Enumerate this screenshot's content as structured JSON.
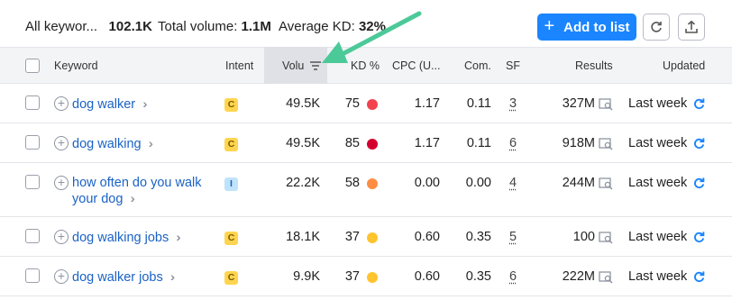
{
  "topbar": {
    "all_keywords_label": "All keywor...",
    "all_keywords_value": "102.1K",
    "total_volume_label": "Total volume:",
    "total_volume_value": "1.1M",
    "avg_kd_label": "Average KD:",
    "avg_kd_value": "32%",
    "add_to_list_label": "Add to list"
  },
  "header": {
    "keyword": "Keyword",
    "intent": "Intent",
    "volume": "Volu",
    "kd": "KD %",
    "cpc": "CPC (U...",
    "com": "Com.",
    "sf": "SF",
    "results": "Results",
    "updated": "Updated"
  },
  "colors": {
    "accent": "#1a85ff",
    "link": "#1a62c6",
    "commercial_badge": "#ffd54f",
    "informational_badge": "#bfe3fb",
    "arrow_annotation": "#4cc998"
  },
  "rows": [
    {
      "keyword_line1": "dog walker",
      "keyword_line2": "",
      "intent": "C",
      "volume": "49.5K",
      "kd": "75",
      "kd_color": "#f2424e",
      "cpc": "1.17",
      "com": "0.11",
      "sf": "3",
      "results": "327M",
      "updated": "Last week"
    },
    {
      "keyword_line1": "dog walking",
      "keyword_line2": "",
      "intent": "C",
      "volume": "49.5K",
      "kd": "85",
      "kd_color": "#d3002f",
      "cpc": "1.17",
      "com": "0.11",
      "sf": "6",
      "results": "918M",
      "updated": "Last week"
    },
    {
      "keyword_line1": "how often do you walk",
      "keyword_line2": "your dog",
      "intent": "I",
      "volume": "22.2K",
      "kd": "58",
      "kd_color": "#ff8c42",
      "cpc": "0.00",
      "com": "0.00",
      "sf": "4",
      "results": "244M",
      "updated": "Last week"
    },
    {
      "keyword_line1": "dog walking jobs",
      "keyword_line2": "",
      "intent": "C",
      "volume": "18.1K",
      "kd": "37",
      "kd_color": "#ffc42e",
      "cpc": "0.60",
      "com": "0.35",
      "sf": "5",
      "results": "100",
      "updated": "Last week"
    },
    {
      "keyword_line1": "dog walker jobs",
      "keyword_line2": "",
      "intent": "C",
      "volume": "9.9K",
      "kd": "37",
      "kd_color": "#ffc42e",
      "cpc": "0.60",
      "com": "0.35",
      "sf": "6",
      "results": "222M",
      "updated": "Last week"
    }
  ]
}
